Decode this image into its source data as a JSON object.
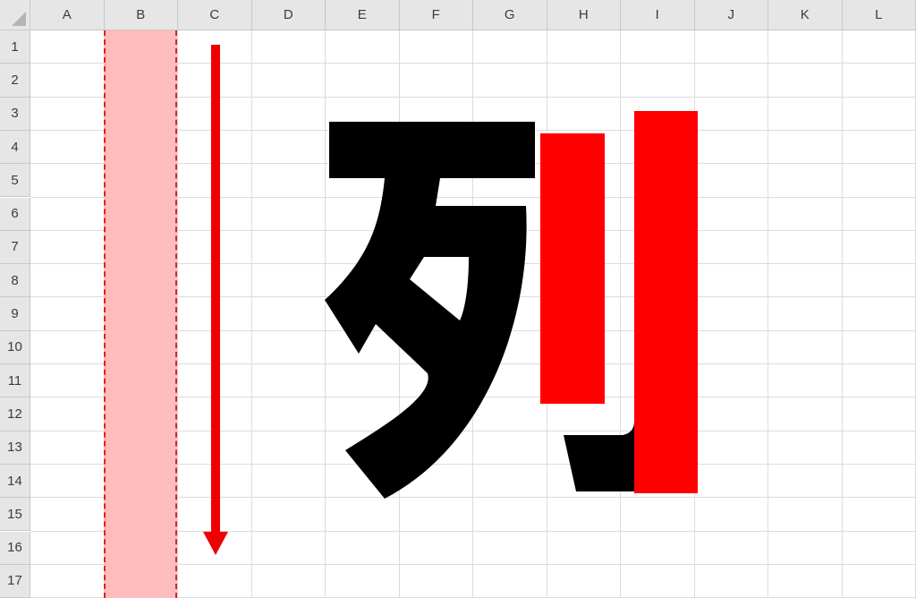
{
  "spreadsheet": {
    "columns": [
      "A",
      "B",
      "C",
      "D",
      "E",
      "F",
      "G",
      "H",
      "I",
      "J",
      "K",
      "L"
    ],
    "rows": [
      "1",
      "2",
      "3",
      "4",
      "5",
      "6",
      "7",
      "8",
      "9",
      "10",
      "11",
      "12",
      "13",
      "14",
      "15",
      "16",
      "17"
    ],
    "highlighted_column": "B"
  },
  "colors": {
    "header_bg": "#e6e6e6",
    "gridline": "#dcdcdc",
    "highlight_fill": "#ffbcbc",
    "highlight_border": "#e02020",
    "arrow": "#ee0000",
    "glyph_black": "#000000",
    "glyph_red": "#ff0000"
  },
  "illustration": {
    "arrow_icon": "arrow-down-icon",
    "glyph_highlighted_radical": "刂"
  }
}
